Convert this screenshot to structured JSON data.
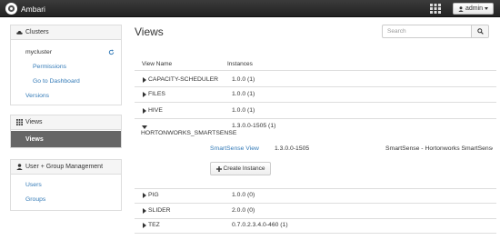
{
  "navbar": {
    "brand": "Ambari",
    "user_label": "admin"
  },
  "sidebar": {
    "clusters": {
      "heading": "Clusters",
      "cluster_name": "mycluster",
      "links": [
        "Permissions",
        "Go to Dashboard"
      ],
      "versions_label": "Versions"
    },
    "views": {
      "heading": "Views",
      "active_item": "Views"
    },
    "user_group": {
      "heading": "User + Group Management",
      "links": [
        "Users",
        "Groups"
      ]
    }
  },
  "main": {
    "title": "Views",
    "search": {
      "placeholder": "Search",
      "value": ""
    },
    "table": {
      "headers": [
        "View Name",
        "Instances"
      ],
      "rows": [
        {
          "name": "CAPACITY-SCHEDULER",
          "instances": "1.0.0 (1)"
        },
        {
          "name": "FILES",
          "instances": "1.0.0 (1)"
        },
        {
          "name": "HIVE",
          "instances": "1.0.0 (1)"
        },
        {
          "name": "HORTONWORKS_SMARTSENSE",
          "instances": "1.3.0.0-1505 (1)"
        },
        {
          "name": "PIG",
          "instances": "1.0.0 (0)"
        },
        {
          "name": "SLIDER",
          "instances": "2.0.0 (0)"
        },
        {
          "name": "TEZ",
          "instances": "0.7.0.2.3.4.0-460 (1)"
        }
      ],
      "expanded": {
        "instance_name": "SmartSense View",
        "version": "1.3.0.0-1505",
        "description": "SmartSense - Hortonworks SmartSense",
        "create_label": "Create Instance"
      }
    }
  }
}
